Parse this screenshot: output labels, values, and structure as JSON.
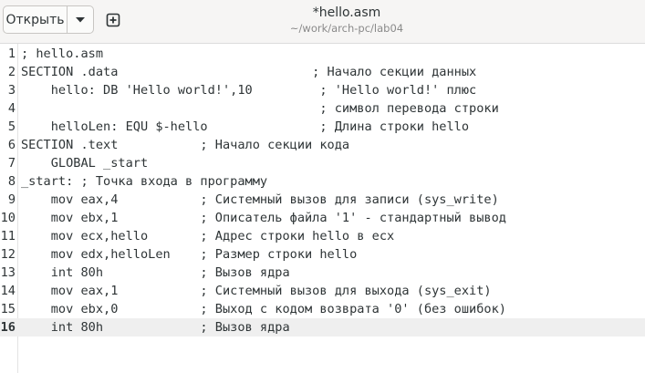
{
  "header": {
    "open_label": "Открыть",
    "open_menu_icon": "chevron-down-icon",
    "new_tab_icon": "new-tab-icon",
    "title": "*hello.asm",
    "subtitle": "~/work/arch-pc/lab04"
  },
  "editor": {
    "current_line": 16,
    "lines": [
      {
        "num": "1",
        "text": "; hello.asm"
      },
      {
        "num": "2",
        "text": "SECTION .data                          ; Начало секции данных"
      },
      {
        "num": "3",
        "text": "    hello: DB 'Hello world!',10         ; 'Hello world!' плюс"
      },
      {
        "num": "4",
        "text": "                                        ; символ перевода строки"
      },
      {
        "num": "5",
        "text": "    helloLen: EQU $-hello               ; Длина строки hello"
      },
      {
        "num": "6",
        "text": "SECTION .text           ; Начало секции кода"
      },
      {
        "num": "7",
        "text": "    GLOBAL _start"
      },
      {
        "num": "8",
        "text": "_start: ; Точка входа в программу"
      },
      {
        "num": "9",
        "text": "    mov eax,4           ; Системный вызов для записи (sys_write)"
      },
      {
        "num": "10",
        "text": "    mov ebx,1           ; Описатель файла '1' - стандартный вывод"
      },
      {
        "num": "11",
        "text": "    mov ecx,hello       ; Адрес строки hello в ecx"
      },
      {
        "num": "12",
        "text": "    mov edx,helloLen    ; Размер строки hello"
      },
      {
        "num": "13",
        "text": "    int 80h             ; Вызов ядра"
      },
      {
        "num": "14",
        "text": "    mov eax,1           ; Системный вызов для выхода (sys_exit)"
      },
      {
        "num": "15",
        "text": "    mov ebx,0           ; Выход с кодом возврата '0' (без ошибок)"
      },
      {
        "num": "16",
        "text": "    int 80h             ; Вызов ядра"
      }
    ]
  }
}
